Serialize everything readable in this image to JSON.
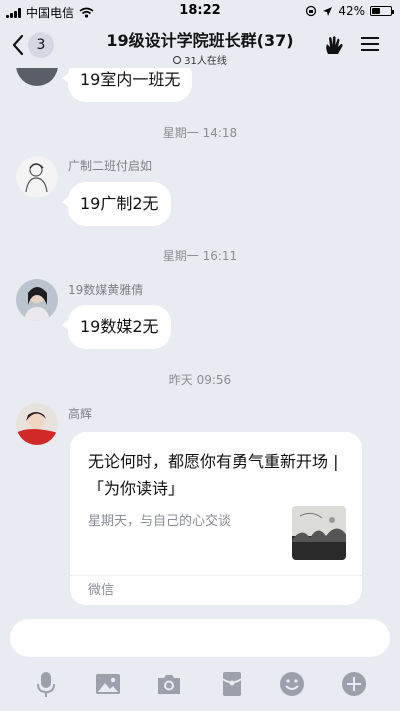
{
  "status_bar": {
    "carrier": "中国电信",
    "time": "18:22",
    "battery": "42%",
    "battery_level": 0.42
  },
  "header": {
    "back_count": "3",
    "title": "19级设计学院班长群(37)",
    "online": "31人在线"
  },
  "messages": [
    {
      "text": "19室内一班无"
    },
    {
      "time": "星期一 14:18"
    },
    {
      "sender": "广制二班付启如",
      "text": "19广制2无"
    },
    {
      "time": "星期一 16:11"
    },
    {
      "sender": "19数媒黄雅倩",
      "text": "19数媒2无"
    },
    {
      "time": "昨天 09:56"
    },
    {
      "sender": "高辉"
    }
  ],
  "card": {
    "title": "无论何时，都愿你有勇气重新开场 | 「为你读诗」",
    "desc": "星期天，与自己的心交谈",
    "source": "微信"
  },
  "colors": {
    "background": "#e9ebf3",
    "bubble": "#ffffff",
    "muted": "#8a8d97",
    "icon": "#9ca0ab"
  },
  "icons": [
    "microphone-icon",
    "image-icon",
    "camera-icon",
    "red-packet-icon",
    "emoji-icon",
    "plus-icon"
  ]
}
